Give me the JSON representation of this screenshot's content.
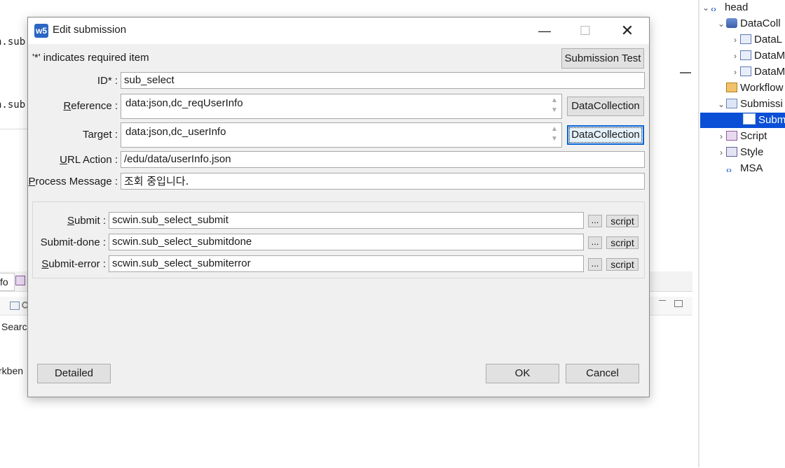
{
  "background": {
    "code_lines": [
      "n.sub",
      "n.sub"
    ],
    "bottom_tab_label": "fo",
    "search_text": "Searc",
    "workbench_text": "rkben"
  },
  "outline": {
    "items": [
      {
        "label": "head",
        "icon": "tag-icon",
        "twisty": "expanded"
      },
      {
        "label": "DataColl",
        "icon": "database-icon",
        "twisty": "expanded"
      },
      {
        "label": "DataL",
        "icon": "datalist-icon",
        "twisty": "collapsed"
      },
      {
        "label": "DataM",
        "icon": "datamap-icon",
        "twisty": "collapsed"
      },
      {
        "label": "DataM",
        "icon": "datamap-icon",
        "twisty": "collapsed"
      },
      {
        "label": "Workflow",
        "icon": "workflow-icon",
        "twisty": "none"
      },
      {
        "label": "Submissi",
        "icon": "submission-icon",
        "twisty": "expanded"
      },
      {
        "label": "Subm",
        "icon": "submission-item-icon",
        "twisty": "none",
        "selected": true
      },
      {
        "label": "Script",
        "icon": "script-icon",
        "twisty": "collapsed"
      },
      {
        "label": "Style",
        "icon": "style-icon",
        "twisty": "collapsed"
      },
      {
        "label": "MSA",
        "icon": "tag-icon",
        "twisty": "none"
      }
    ]
  },
  "dialog": {
    "title": "Edit submission",
    "app_icon_text": "w5",
    "required_note": "'*' indicates required item",
    "submission_test_label": "Submission Test",
    "fields": {
      "id": {
        "label": "ID* :",
        "value": "sub_select"
      },
      "reference": {
        "label_mnemonic": "R",
        "label_rest": "eference :",
        "value": "data:json,dc_reqUserInfo"
      },
      "target": {
        "label": "Target :",
        "value": "data:json,dc_userInfo"
      },
      "url_action": {
        "label_mnemonic": "U",
        "label_rest": "RL Action :",
        "value": "/edu/data/userInfo.json"
      },
      "process_message": {
        "label_mnemonic": "P",
        "label_rest": "rocess Message :",
        "value": "조회 중입니다."
      }
    },
    "datacollection_label": "DataCollection",
    "events": [
      {
        "label_mnemonic": "S",
        "label_rest": "ubmit :",
        "value": "scwin.sub_select_submit"
      },
      {
        "label_mnemonic": "",
        "label_rest": "Submit-done :",
        "value": "scwin.sub_select_submitdone"
      },
      {
        "label_mnemonic": "S",
        "label_rest": "ubmit-error :",
        "value": "scwin.sub_select_submiterror"
      }
    ],
    "ellipsis_label": "...",
    "script_label": "script",
    "detailed_label": "Detailed",
    "ok_label": "OK",
    "cancel_label": "Cancel"
  }
}
